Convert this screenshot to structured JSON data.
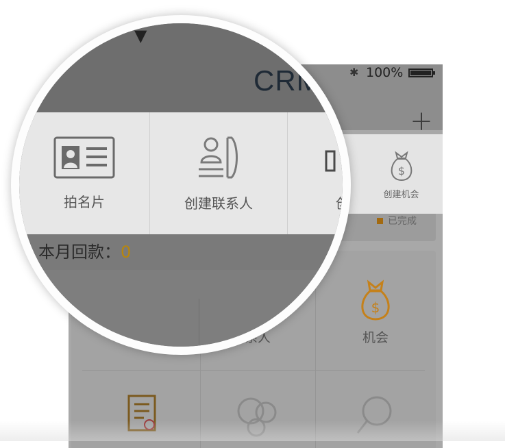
{
  "status_bar": {
    "battery_text": "100%"
  },
  "nav": {
    "title": "CRM",
    "add_label": "+"
  },
  "popup_menu": {
    "items": [
      {
        "label": "拍名片",
        "icon": "business-card-icon"
      },
      {
        "label": "创建联系人",
        "icon": "create-contact-icon"
      },
      {
        "label": "创",
        "icon": "create-icon"
      },
      {
        "label": "创建机会",
        "icon": "money-bag-icon"
      }
    ]
  },
  "summary": {
    "prefix": "本月回款：",
    "value": "0",
    "legend_done": "已完成"
  },
  "grid": {
    "items": [
      {
        "label": "系人",
        "icon": "contact-icon"
      },
      {
        "label": "机会",
        "icon": "money-bag-icon"
      },
      {
        "label": "",
        "icon": "document-icon"
      },
      {
        "label": "",
        "icon": "bubbles-icon"
      },
      {
        "label": "",
        "icon": "search-icon"
      }
    ]
  },
  "colors": {
    "accent": "#c5811a",
    "overlay": "#a8a8a8",
    "menu_bg": "#e6e6e6"
  }
}
